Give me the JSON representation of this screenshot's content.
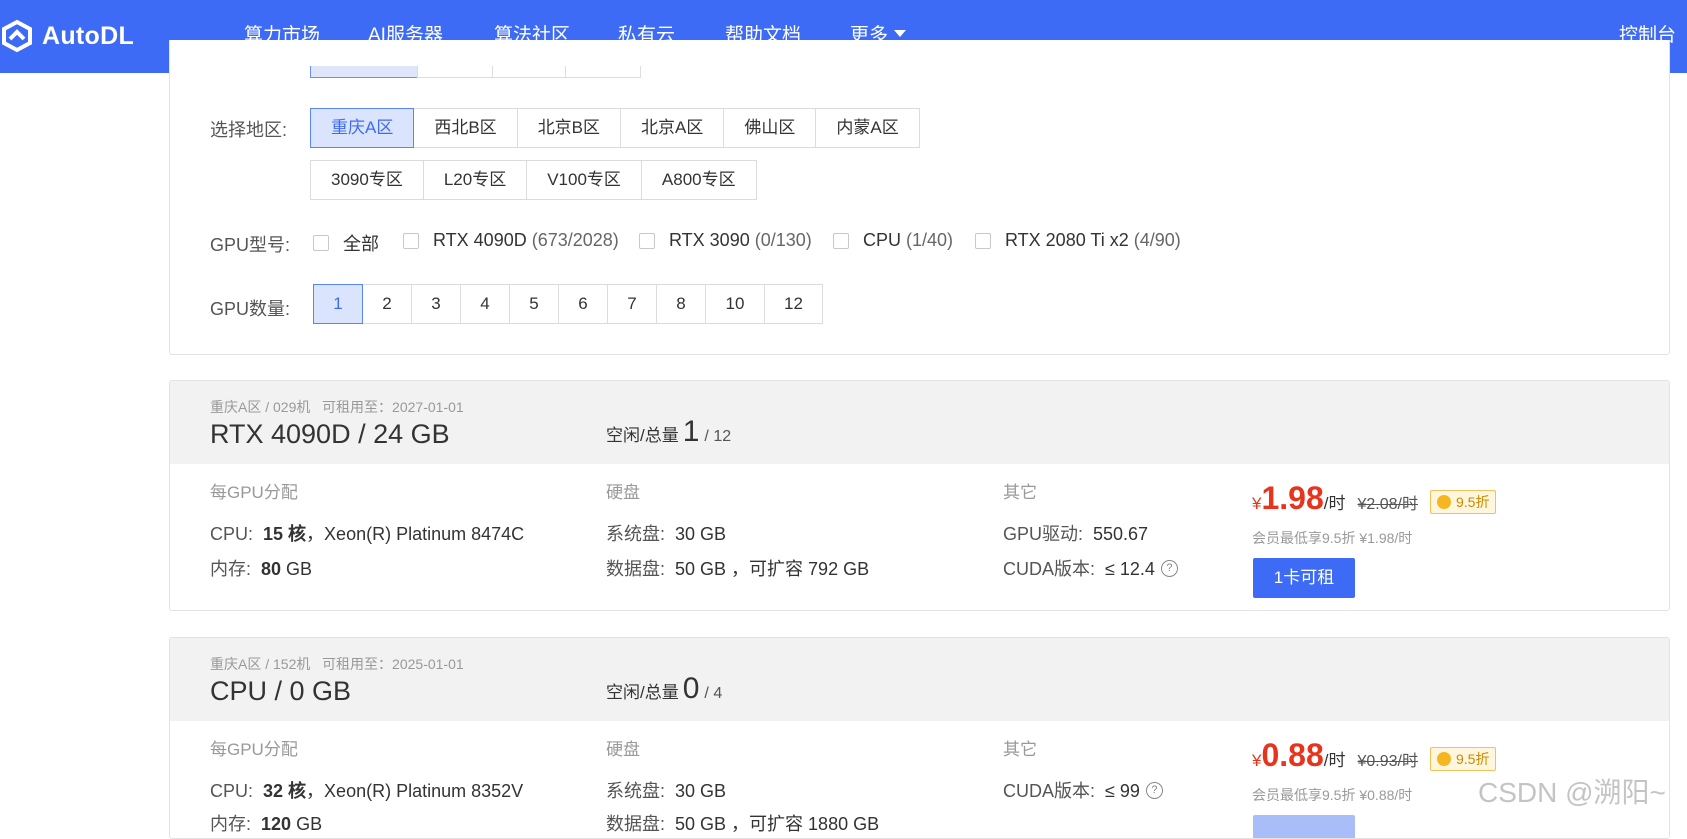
{
  "nav": {
    "logo": "AutoDL",
    "items": [
      "算力市场",
      "AI服务器",
      "算法社区",
      "私有云",
      "帮助文档",
      "更多"
    ],
    "console": "控制台"
  },
  "filters": {
    "region_label": "选择地区:",
    "regions_row1": [
      "重庆A区",
      "西北B区",
      "北京B区",
      "北京A区",
      "佛山区",
      "内蒙A区"
    ],
    "regions_row2": [
      "3090专区",
      "L20专区",
      "V100专区",
      "A800专区"
    ],
    "gpu_model_label": "GPU型号:",
    "gpu_models": [
      {
        "name": "全部",
        "count": ""
      },
      {
        "name": "RTX 4090D",
        "count": "(673/2028)"
      },
      {
        "name": "RTX 3090",
        "count": "(0/130)"
      },
      {
        "name": "CPU",
        "count": "(1/40)"
      },
      {
        "name": "RTX 2080 Ti x2",
        "count": "(4/90)"
      }
    ],
    "gpu_count_label": "GPU数量:",
    "gpu_counts": [
      "1",
      "2",
      "3",
      "4",
      "5",
      "6",
      "7",
      "8",
      "10",
      "12"
    ]
  },
  "machines": [
    {
      "location": "重庆A区 / 029机",
      "rent_until": "可租用至：2027-01-01",
      "title": "RTX 4090D / 24 GB",
      "idle_label": "空闲/总量",
      "free": "1",
      "total": "/ 12",
      "col1_header": "每GPU分配",
      "cpu_key": "CPU:",
      "cpu_cores": "15 核",
      "cpu_model": "，Xeon(R) Platinum 8474C",
      "mem_key": "内存:",
      "mem_val": "80",
      "mem_unit": " GB",
      "col2_header": "硬盘",
      "sys_key": "系统盘:",
      "sys_val": "30 GB",
      "data_key": "数据盘:",
      "data_val": "50 GB ，可扩容 792 GB",
      "col3_header": "其它",
      "driver_key": "GPU驱动:",
      "driver_val": "550.67",
      "cuda_key": "CUDA版本:",
      "cuda_val": "≤ 12.4",
      "help_glyph": "?",
      "yen": "¥",
      "price": "1.98",
      "unit": "/时",
      "old_price": "¥2.08/时",
      "discount": "9.5折",
      "member_note": "会员最低享9.5折 ¥1.98/时",
      "rent_label": "1卡可租"
    },
    {
      "location": "重庆A区 / 152机",
      "rent_until": "可租用至：2025-01-01",
      "title": "CPU / 0 GB",
      "idle_label": "空闲/总量",
      "free": "0",
      "total": "/ 4",
      "col1_header": "每GPU分配",
      "cpu_key": "CPU:",
      "cpu_cores": "32 核",
      "cpu_model": "，Xeon(R) Platinum 8352V",
      "mem_key": "内存:",
      "mem_val": "120",
      "mem_unit": " GB",
      "col2_header": "硬盘",
      "sys_key": "系统盘:",
      "sys_val": "30 GB",
      "data_key": "数据盘:",
      "data_val": "50 GB ，可扩容 1880 GB",
      "col3_header": "其它",
      "cuda_key": "CUDA版本:",
      "cuda_val": "≤ 99",
      "help_glyph": "?",
      "yen": "¥",
      "price": "0.88",
      "unit": "/时",
      "old_price": "¥0.93/时",
      "discount": "9.5折",
      "member_note": "会员最低享9.5折 ¥0.88/时"
    }
  ],
  "watermark": "CSDN @溯阳~",
  "colors": {
    "brand": "#3d6bf6",
    "price": "#e8341c",
    "discount_bg": "#fff6de"
  }
}
